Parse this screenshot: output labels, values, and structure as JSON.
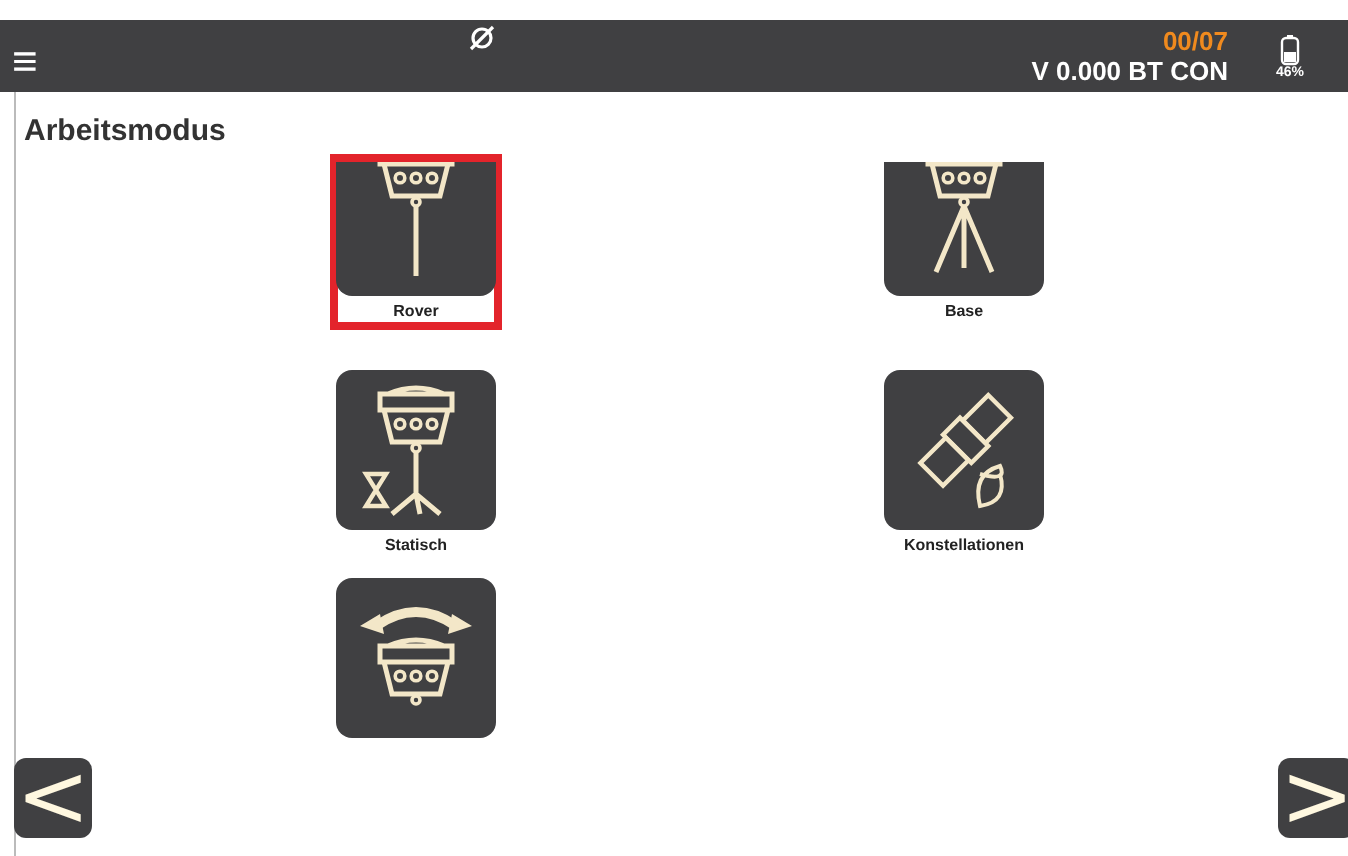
{
  "top_bar": {
    "menu_icon": "≡",
    "satellite_count": "00/07",
    "status": "V 0.000 BT CON",
    "battery": "46%"
  },
  "title": "Arbeitsmodus",
  "modes": [
    {
      "kind": "rover",
      "label": "Rover",
      "selected": true
    },
    {
      "kind": "base",
      "label": "Base",
      "selected": false
    },
    {
      "kind": "static",
      "label": "Statisch",
      "selected": false
    },
    {
      "kind": "constellation",
      "label": "Konstellationen",
      "selected": false
    },
    {
      "kind": "switch",
      "selected": false
    }
  ],
  "nav": {
    "prev": "<",
    "next": ">"
  }
}
